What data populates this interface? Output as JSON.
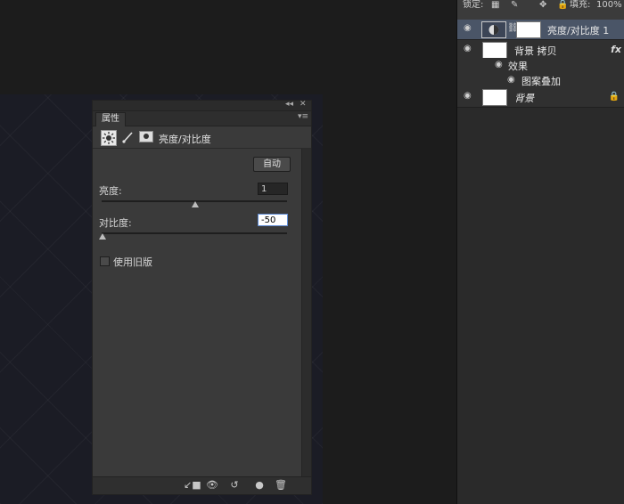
{
  "properties": {
    "tab_label": "属性",
    "adjustment_label": "亮度/对比度",
    "auto_label": "自动",
    "brightness_label": "亮度:",
    "brightness_value": "1",
    "contrast_label": "对比度:",
    "contrast_value": "-50",
    "legacy_label": "使用旧版"
  },
  "layers": {
    "lock_label": "锁定:",
    "fill_label": "填充:",
    "fill_value": "100%",
    "items": [
      {
        "name": "亮度/对比度 1",
        "selected": true
      },
      {
        "name": "背景 拷贝",
        "fx": "fx"
      },
      {
        "name": "效果"
      },
      {
        "name": "图案叠加"
      },
      {
        "name": "背景",
        "italic": true
      }
    ]
  },
  "colors": {
    "selected_layer": "#4a5567",
    "panel_bg": "#3a3a3a",
    "canvas_bg": "#1b1c25"
  }
}
